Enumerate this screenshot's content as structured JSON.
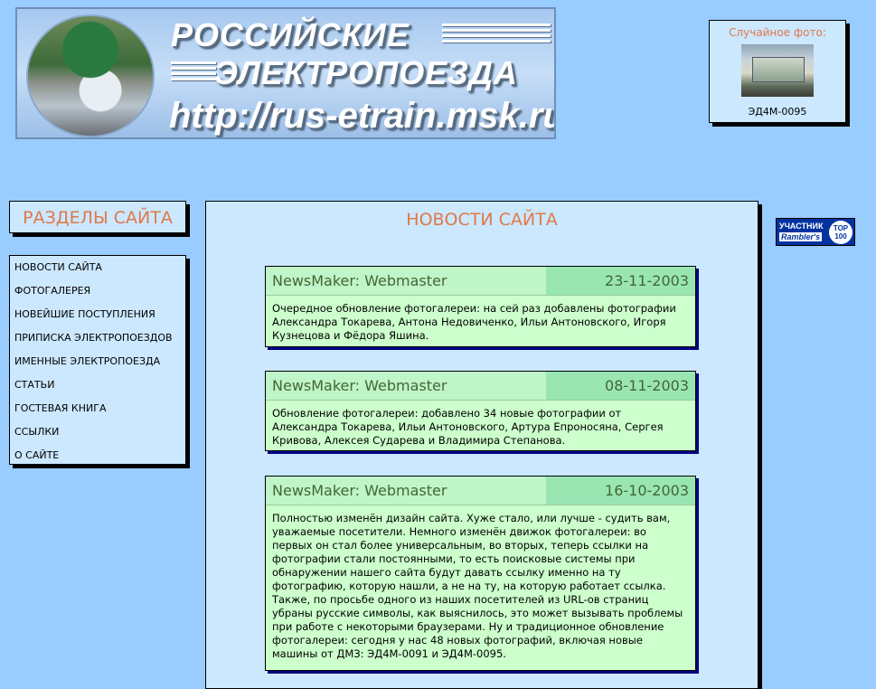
{
  "header": {
    "logo_line1": "РОССИЙСКИЕ",
    "logo_line2": "ЭЛЕКТРОПОЕЗДА",
    "logo_url": "http://rus-etrain.msk.ru"
  },
  "random_photo": {
    "title": "Случайное фото:",
    "caption": "ЭД4М-0095"
  },
  "sidebar": {
    "heading": "РАЗДЕЛЫ САЙТА",
    "items": [
      {
        "label": "НОВОСТИ САЙТА"
      },
      {
        "label": "ФОТОГАЛЕРЕЯ"
      },
      {
        "label": "НОВЕЙШИЕ ПОСТУПЛЕНИЯ"
      },
      {
        "label": "ПРИПИСКА ЭЛЕКТРОПОЕЗДОВ"
      },
      {
        "label": "ИМЕННЫЕ ЭЛЕКТРОПОЕЗДА"
      },
      {
        "label": "СТАТЬИ"
      },
      {
        "label": "ГОСТЕВАЯ КНИГА"
      },
      {
        "label": "ССЫЛКИ"
      },
      {
        "label": "О САЙТЕ"
      }
    ]
  },
  "main": {
    "title": "НОВОСТИ САЙТА",
    "news": [
      {
        "author": "NewsMaker: Webmaster",
        "date": "23-11-2003",
        "text": "Очередное обновление фотогалереи: на сей раз добавлены фотографии Александра Токарева, Антона Недовиченко, Ильи Антоновского, Игоря Кузнецова и Фёдора Яшина."
      },
      {
        "author": "NewsMaker: Webmaster",
        "date": "08-11-2003",
        "text": "Обновление фотогалереи: добавлено 34 новые фотографии от Александра Токарева, Ильи Антоновского, Артура Епроносяна, Сергея Кривова, Алексея Сударева и Владимира Степанова."
      },
      {
        "author": "NewsMaker: Webmaster",
        "date": "16-10-2003",
        "text": "Полностью изменён дизайн сайта. Хуже стало, или лучше - судить вам, уважаемые посетители. Немного изменён движок фотогалереи: во первых он стал более универсальным, во вторых, теперь ссылки на фотографии стали постоянными, то есть поисковые системы при обнаружении нашего сайта будут давать ссылку именно на ту фотографию, которую нашли, а не на ту, на которую работает ссылка. Также, по просьбе одного из наших посетителей из URL-ов страниц убраны русские символы, как выяснилось, это может вызывать проблемы при работе с некоторыми браузерами. Ну и традиционное обновление фотогалереи: сегодня у нас 48 новых фотографий, включая новые машины от ДМЗ: ЭД4М-0091 и ЭД4М-0095."
      }
    ]
  },
  "rambler": {
    "line1": "УЧАСТНИК",
    "line2": "Rambler's",
    "top": "TOP 100"
  }
}
